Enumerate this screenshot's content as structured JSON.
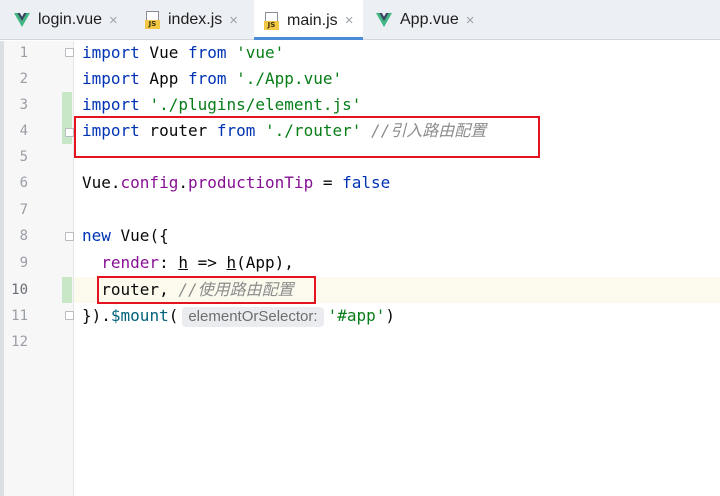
{
  "tabs": [
    {
      "label": "login.vue",
      "icon": "vue-icon"
    },
    {
      "label": "index.js",
      "icon": "js-file-icon"
    },
    {
      "label": "main.js",
      "icon": "js-file-icon",
      "active": true
    },
    {
      "label": "App.vue",
      "icon": "vue-icon"
    }
  ],
  "js_badge": "JS",
  "close_glyph": "×",
  "line_numbers": [
    "1",
    "2",
    "3",
    "4",
    "5",
    "6",
    "7",
    "8",
    "9",
    "10",
    "11",
    "12"
  ],
  "code": {
    "l1": {
      "kw1": "import",
      "t1": " Vue ",
      "kw2": "from",
      "sp": " ",
      "str": "'vue'"
    },
    "l2": {
      "kw1": "import",
      "t1": " App ",
      "kw2": "from",
      "sp": " ",
      "str": "'./App.vue'"
    },
    "l3": {
      "kw1": "import",
      "sp": " ",
      "str": "'./plugins/element.js'"
    },
    "l4": {
      "kw1": "import",
      "t1": " router ",
      "kw2": "from",
      "sp": " ",
      "str": "'./router'",
      "sp2": " ",
      "cmt": "//引入路由配置"
    },
    "l6": {
      "t1": "Vue.",
      "prop1": "config",
      "dot": ".",
      "prop2": "productionTip",
      "t2": " = ",
      "kw": "false"
    },
    "l8": {
      "kw": "new",
      "t1": " Vue({"
    },
    "l9": {
      "indent": "  ",
      "prop": "render",
      "t1": ": ",
      "p1": "h",
      "t2": " => ",
      "p2": "h",
      "t3": "(App),"
    },
    "l10": {
      "indent": "  ",
      "t1": "router, ",
      "cmt": "//使用路由配置"
    },
    "l11": {
      "t1": "}).",
      "fn": "$mount",
      "t2": "(",
      "hint": "elementOrSelector:",
      "str": "'#app'",
      "t3": ")"
    }
  },
  "colors": {
    "keyword": "#0033b3",
    "string": "#067d17",
    "property": "#871094",
    "comment": "#8c8c8c",
    "highlight_box": "#e5121f",
    "active_tab_underline": "#4a8bd6",
    "vue_green": "#41b883",
    "vue_dark": "#35495e"
  }
}
